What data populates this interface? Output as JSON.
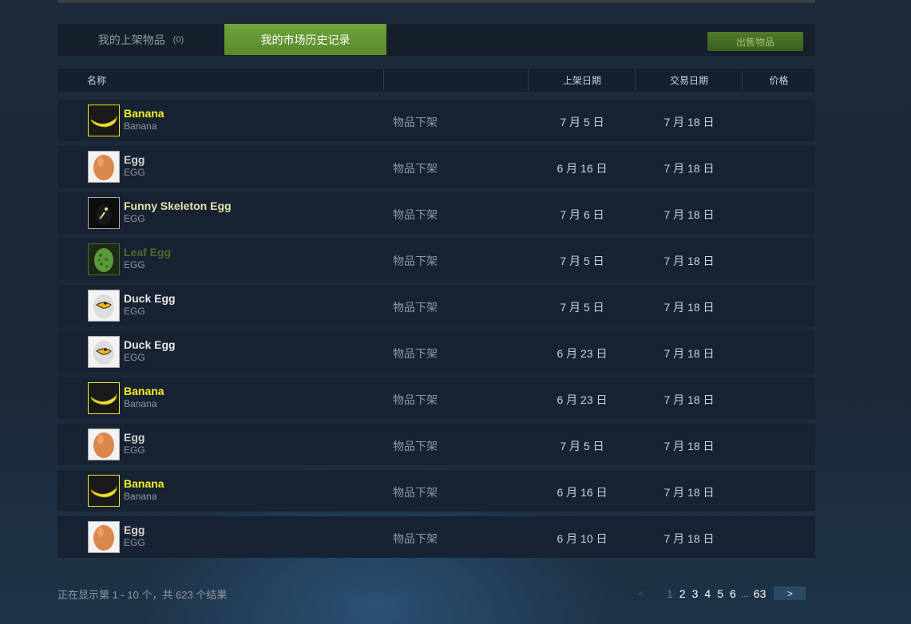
{
  "tabs": {
    "listings_label": "我的上架物品",
    "listings_count": "(0)",
    "history_label": "我的市场历史记录",
    "sell_button": "出售物品"
  },
  "table": {
    "headers": {
      "name": "名称",
      "listed": "上架日期",
      "traded": "交易日期",
      "price": "价格"
    },
    "rows": [
      {
        "item": "Banana",
        "game": "Banana",
        "icon": "banana-icon",
        "name_color": "#f5f21f",
        "status": "物品下架",
        "listed": "7 月 5 日",
        "traded": "7 月 18 日"
      },
      {
        "item": "Egg",
        "game": "EGG",
        "icon": "egg-icon",
        "name_color": "#d2d2d2",
        "status": "物品下架",
        "listed": "6 月 16 日",
        "traded": "7 月 18 日"
      },
      {
        "item": "Funny Skeleton Egg",
        "game": "EGG",
        "icon": "skeleton-egg-icon",
        "name_color": "#e8e2a8",
        "status": "物品下架",
        "listed": "7 月 6 日",
        "traded": "7 月 18 日"
      },
      {
        "item": "Leaf Egg",
        "game": "EGG",
        "icon": "leaf-egg-icon",
        "name_color": "#4b6b2b",
        "status": "物品下架",
        "listed": "7 月 5 日",
        "traded": "7 月 18 日"
      },
      {
        "item": "Duck Egg",
        "game": "EGG",
        "icon": "duck-egg-icon",
        "name_color": "#e8e8e8",
        "status": "物品下架",
        "listed": "7 月 5 日",
        "traded": "7 月 18 日"
      },
      {
        "item": "Duck Egg",
        "game": "EGG",
        "icon": "duck-egg-icon",
        "name_color": "#e8e8e8",
        "status": "物品下架",
        "listed": "6 月 23 日",
        "traded": "7 月 18 日"
      },
      {
        "item": "Banana",
        "game": "Banana",
        "icon": "banana-icon",
        "name_color": "#f5f21f",
        "status": "物品下架",
        "listed": "6 月 23 日",
        "traded": "7 月 18 日"
      },
      {
        "item": "Egg",
        "game": "EGG",
        "icon": "egg-icon",
        "name_color": "#d2d2d2",
        "status": "物品下架",
        "listed": "7 月 5 日",
        "traded": "7 月 18 日"
      },
      {
        "item": "Banana",
        "game": "Banana",
        "icon": "banana-icon",
        "name_color": "#f5f21f",
        "status": "物品下架",
        "listed": "6 月 16 日",
        "traded": "7 月 18 日"
      },
      {
        "item": "Egg",
        "game": "EGG",
        "icon": "egg-icon",
        "name_color": "#d2d2d2",
        "status": "物品下架",
        "listed": "6 月 10 日",
        "traded": "7 月 18 日"
      }
    ]
  },
  "footer": {
    "summary": "正在显示第 1 - 10 个，共 623 个结果",
    "prev": "<",
    "next": ">",
    "pages": [
      "1",
      "2",
      "3",
      "4",
      "5",
      "6"
    ],
    "ellipsis": "...",
    "last_page": "63",
    "current_page": "1"
  }
}
